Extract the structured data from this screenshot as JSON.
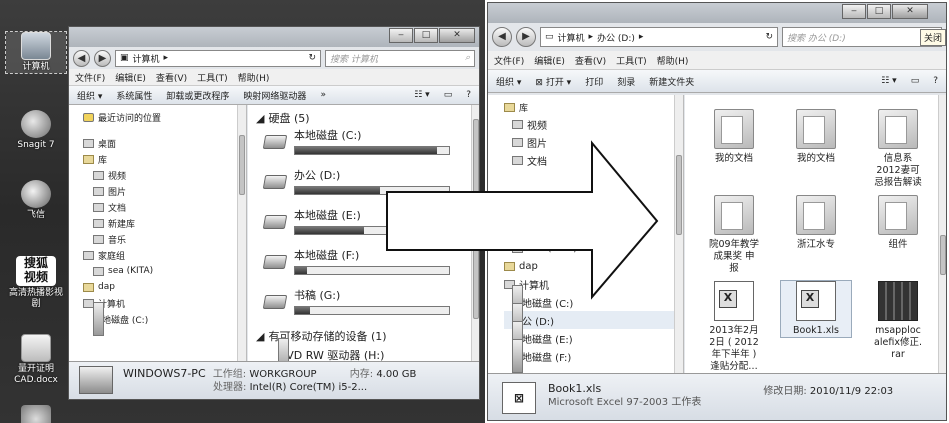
{
  "desktop": {
    "icons": [
      {
        "label": "计算机",
        "icon": "computer-icon"
      },
      {
        "label": "Snagit 7",
        "icon": "snagit-icon"
      },
      {
        "label": "飞信",
        "icon": "fetion-icon"
      },
      {
        "label": "搜狐视频",
        "icon": "sohu-video-icon",
        "glyph": "搜狐\n视频",
        "label2": "高清热播影视剧"
      },
      {
        "label": "量开证明\nCAD.docx",
        "icon": "word-doc-icon"
      }
    ]
  },
  "left_window": {
    "address": [
      "计算机",
      "▸"
    ],
    "search_placeholder": "搜索 计算机",
    "menu": [
      "文件(F)",
      "编辑(E)",
      "查看(V)",
      "工具(T)",
      "帮助(H)"
    ],
    "toolbar": [
      "组织 ▾",
      "系统属性",
      "卸载或更改程序",
      "映射网络驱动器",
      "»"
    ],
    "nav": [
      "最近访问的位置",
      "桌面",
      "库",
      "视频",
      "图片",
      "文档",
      "新建库",
      "音乐",
      "家庭组",
      "sea (KITA)",
      "dap",
      "计算机",
      "本地磁盘 (C:)"
    ],
    "group_hard_disk": "硬盘 (5)",
    "drives": [
      {
        "name": "本地磁盘 (C:)",
        "used": 0.92
      },
      {
        "name": "办公 (D:)",
        "used": 0.55
      },
      {
        "name": "本地磁盘 (E:)",
        "used": 0.45
      },
      {
        "name": "本地磁盘 (F:)",
        "used": 0.08
      },
      {
        "name": "书稿 (G:)",
        "used": 0.1
      }
    ],
    "group_removable": "有可移动存储的设备 (1)",
    "removable_item": "DVD RW 驱动器 (H:)",
    "details": {
      "computer_name": "WINDOWS7-PC",
      "workgroup_label": "工作组:",
      "workgroup": "WORKGROUP",
      "memory_label": "内存:",
      "memory": "4.00 GB",
      "cpu_label": "处理器:",
      "cpu": "Intel(R) Core(TM) i5-2..."
    }
  },
  "right_window": {
    "tooltip": "关闭",
    "address": [
      "计算机",
      "▸",
      "办公 (D:)",
      "▸"
    ],
    "search_placeholder": "搜索 办公 (D:)",
    "menu": [
      "文件(F)",
      "编辑(E)",
      "查看(V)",
      "工具(T)",
      "帮助(H)"
    ],
    "toolbar": [
      "组织 ▾",
      "打开 ▾",
      "打印",
      "刻录",
      "新建文件夹"
    ],
    "nav": [
      "库",
      "视频",
      "图片",
      "文档",
      "sea (KITA)",
      "dap",
      "计算机",
      "本地磁盘 (C:)",
      "办公 (D:)",
      "本地磁盘 (E:)",
      "本地磁盘 (F:)"
    ],
    "files": [
      {
        "name": "我的文档",
        "type": "folder"
      },
      {
        "name": "我的文档",
        "type": "folder"
      },
      {
        "name": "信息系\n2012妻可\n忌报告解读",
        "type": "folder"
      },
      {
        "name": "院09年教学\n成果奖 申\n报",
        "type": "folder"
      },
      {
        "name": "浙江水专",
        "type": "folder"
      },
      {
        "name": "组件",
        "type": "folder"
      },
      {
        "name": "2013年2月\n2日 ( 2012\n年下半年 )\n逢贴分配…",
        "type": "xls"
      },
      {
        "name": "Book1.xls",
        "type": "xls"
      },
      {
        "name": "msapploc\nalefix修正.\nrar",
        "type": "rar"
      }
    ],
    "details": {
      "file_name": "Book1.xls",
      "file_type": "Microsoft Excel 97-2003 工作表",
      "modified_label": "修改日期:",
      "modified": "2010/11/9 22:03"
    }
  }
}
